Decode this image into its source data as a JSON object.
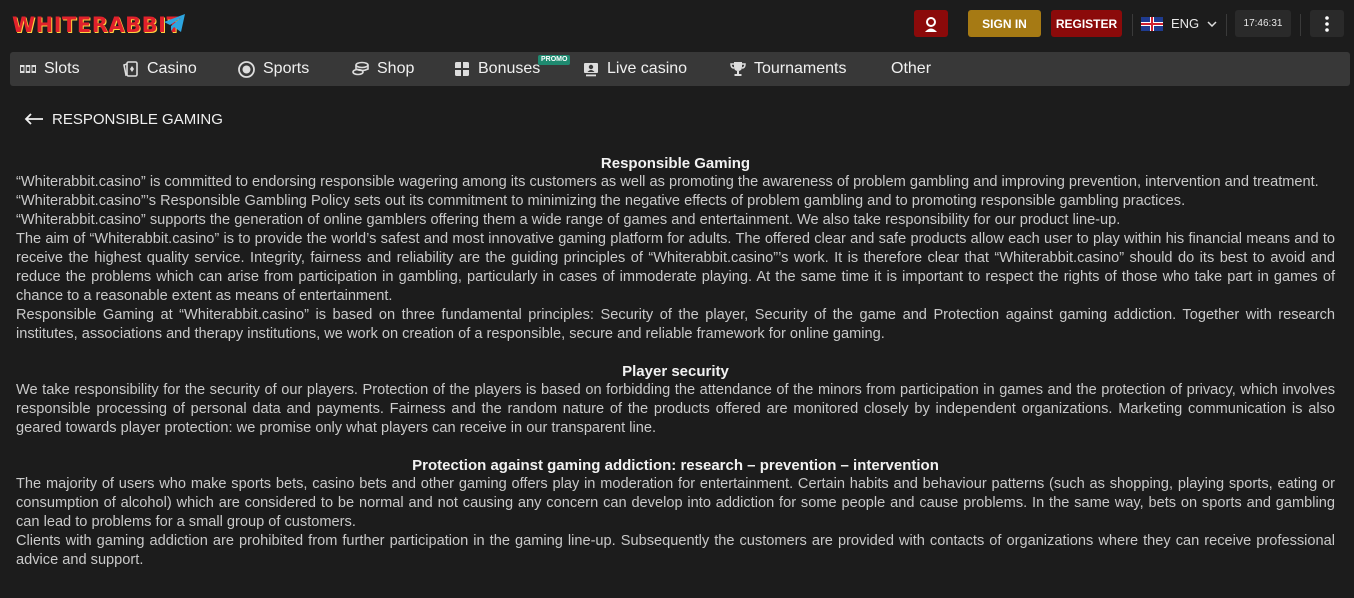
{
  "header": {
    "logo_text": "WHITERABBIT",
    "signin_label": "SIGN IN",
    "register_label": "REGISTER",
    "language": "ENG",
    "time": "17:46:31"
  },
  "nav": {
    "items": [
      {
        "label": "Slots"
      },
      {
        "label": "Casino"
      },
      {
        "label": "Sports"
      },
      {
        "label": "Shop"
      },
      {
        "label": "Bonuses"
      },
      {
        "label": "Live casino"
      },
      {
        "label": "Tournaments"
      },
      {
        "label": "Other"
      }
    ],
    "promo_badge": "PROMO"
  },
  "page": {
    "back_label": "RESPONSIBLE GAMING"
  },
  "sections": [
    {
      "title": "Responsible Gaming",
      "paragraphs": [
        "“Whiterabbit.casino” is committed to endorsing responsible wagering among its customers as well as promoting the awareness of problem gambling and improving prevention, intervention and treatment.",
        "“Whiterabbit.casino”’s Responsible Gambling Policy sets out its commitment to minimizing the negative effects of problem gambling and to promoting responsible gambling practices.",
        "“Whiterabbit.casino” supports the generation of online gamblers offering them a wide range of games and entertainment. We also take responsibility for our product line-up.",
        "The aim of “Whiterabbit.casino” is to provide the world’s safest and most innovative gaming platform for adults. The offered clear and safe products allow each user to play within his financial means and to receive the highest quality service. Integrity, fairness and reliability are the guiding principles of “Whiterabbit.casino”’s work. It is therefore clear that “Whiterabbit.casino” should do its best to avoid and reduce the problems which can arise from participation in gambling, particularly in cases of immoderate playing. At the same time it is important to respect the rights of those who take part in games of chance to a reasonable extent as means of entertainment.",
        "Responsible Gaming at “Whiterabbit.casino” is based on three fundamental principles: Security of the player, Security of the game and Protection against gaming addiction. Together with research institutes, associations and therapy institutions, we work on creation of a responsible, secure and reliable framework for online gaming."
      ]
    },
    {
      "title": "Player security",
      "paragraphs": [
        "We take responsibility for the security of our players. Protection of the players is based on forbidding the attendance of the minors from participation in games and the protection of privacy, which involves responsible processing of personal data and payments. Fairness and the random nature of the products offered are monitored closely by independent organizations. Marketing communication is also geared towards player protection: we promise only what players can receive in our transparent line."
      ]
    },
    {
      "title": "Protection against gaming addiction: research – prevention – intervention",
      "paragraphs": [
        "The majority of users who make sports bets, casino bets and other gaming offers play in moderation for entertainment. Certain habits and behaviour patterns (such as shopping, playing sports, eating or consumption of alcohol) which are considered to be normal and not causing any concern can develop into addiction for some people and cause problems. In the same way, bets on sports and gambling can lead to problems for a small group of customers.",
        "Clients with gaming addiction are prohibited from further participation in the gaming line-up. Subsequently the customers are provided with contacts of organizations where they can receive professional advice and support."
      ]
    }
  ]
}
